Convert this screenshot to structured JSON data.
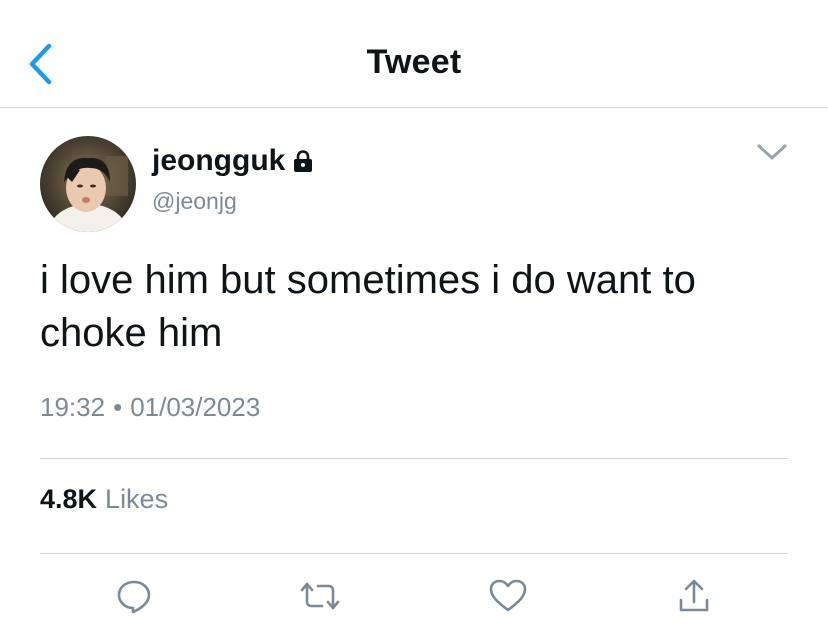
{
  "header": {
    "title": "Tweet",
    "back_icon": "chevron-left-icon"
  },
  "tweet": {
    "author": {
      "name": "jeongguk",
      "handle": "@jeonjg",
      "protected_icon": "lock-icon"
    },
    "text": "i love him but sometimes i do want to choke him",
    "time": "19:32",
    "separator": "•",
    "date": "01/03/2023",
    "likes": {
      "count": "4.8K",
      "label": "Likes"
    }
  },
  "actions": [
    {
      "name": "reply",
      "icon": "comment-icon"
    },
    {
      "name": "retweet",
      "icon": "retweet-icon"
    },
    {
      "name": "like",
      "icon": "heart-icon"
    },
    {
      "name": "share",
      "icon": "share-icon"
    }
  ],
  "colors": {
    "accent": "#1d9bf0",
    "text": "#0f1419",
    "muted": "#7c8a95",
    "divider": "#cfd4d8"
  }
}
